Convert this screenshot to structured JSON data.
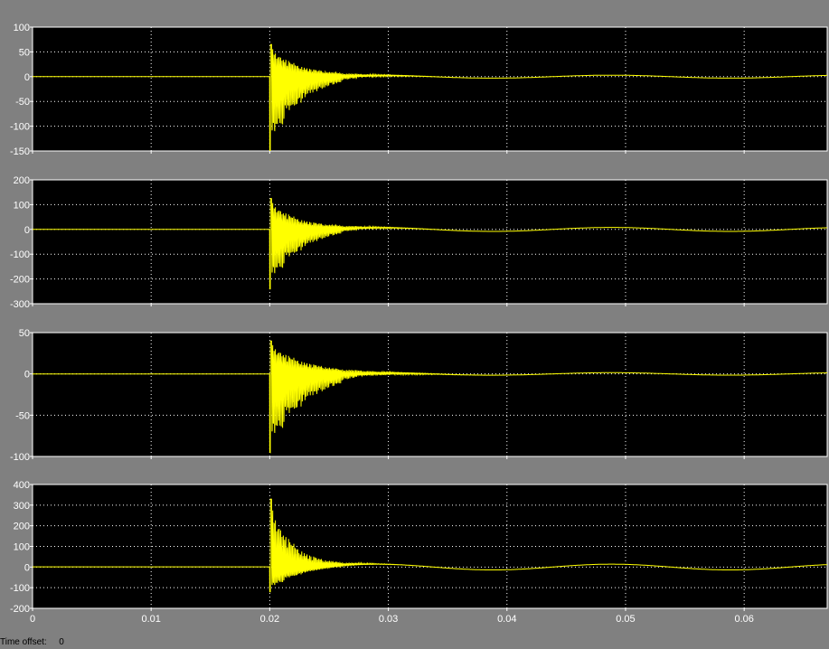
{
  "window": {
    "background": "#808080",
    "time_offset_label": "Time offset:",
    "time_offset_value": "0"
  },
  "colors": {
    "axes_background": "#000000",
    "axes_border": "#ffffff",
    "grid": "#ffffff",
    "signal": "#ffff00",
    "tick_text": "#ffffff"
  },
  "chart_data": [
    {
      "type": "line",
      "title": "",
      "xlabel": "",
      "ylabel": "",
      "xlim": [
        0,
        0.067
      ],
      "ylim": [
        -150,
        100
      ],
      "yticks": [
        -150,
        -100,
        -50,
        0,
        50,
        100
      ],
      "xticks": [
        0,
        0.01,
        0.02,
        0.03,
        0.04,
        0.05,
        0.06
      ],
      "x_tick_labels_shown": false,
      "grid": true,
      "legend": "none",
      "series": [
        {
          "x": [
            0,
            0.02,
            0.0201,
            0.0202,
            0.0204,
            0.0207,
            0.021,
            0.0215,
            0.022,
            0.023,
            0.025,
            0.03,
            0.035,
            0.04,
            0.045,
            0.05,
            0.055,
            0.06,
            0.065,
            0.067
          ],
          "y": [
            0,
            0,
            -140,
            62,
            -75,
            48,
            -30,
            28,
            -18,
            12,
            6,
            1,
            -1,
            0,
            2,
            0,
            -1,
            0,
            1,
            0
          ],
          "transient_start": 0.02,
          "transient_peak": 65,
          "transient_trough": -150,
          "decay_time": 0.0025,
          "ripple": 3
        }
      ]
    },
    {
      "type": "line",
      "title": "",
      "xlabel": "",
      "ylabel": "",
      "xlim": [
        0,
        0.067
      ],
      "ylim": [
        -300,
        200
      ],
      "yticks": [
        -300,
        -200,
        -100,
        0,
        100,
        200
      ],
      "xticks": [
        0,
        0.01,
        0.02,
        0.03,
        0.04,
        0.05,
        0.06
      ],
      "x_tick_labels_shown": false,
      "grid": true,
      "legend": "none",
      "series": [
        {
          "x": [
            0,
            0.02,
            0.0201,
            0.0203,
            0.0205,
            0.0208,
            0.021,
            0.0215,
            0.022,
            0.023,
            0.025,
            0.03,
            0.035,
            0.04,
            0.045,
            0.05,
            0.055,
            0.06,
            0.065,
            0.067
          ],
          "y": [
            0,
            0,
            -235,
            125,
            -110,
            70,
            -60,
            45,
            -30,
            22,
            12,
            4,
            -4,
            -4,
            8,
            4,
            -6,
            -8,
            4,
            6
          ],
          "transient_start": 0.02,
          "transient_peak": 125,
          "transient_trough": -240,
          "decay_time": 0.0025,
          "ripple": 8
        }
      ]
    },
    {
      "type": "line",
      "title": "",
      "xlabel": "",
      "ylabel": "",
      "xlim": [
        0,
        0.067
      ],
      "ylim": [
        -100,
        50
      ],
      "yticks": [
        -100,
        -50,
        0,
        50
      ],
      "xticks": [
        0,
        0.01,
        0.02,
        0.03,
        0.04,
        0.05,
        0.06
      ],
      "x_tick_labels_shown": false,
      "grid": true,
      "legend": "none",
      "series": [
        {
          "x": [
            0,
            0.02,
            0.0201,
            0.0202,
            0.0204,
            0.0207,
            0.021,
            0.0215,
            0.022,
            0.023,
            0.025,
            0.03,
            0.035,
            0.04,
            0.045,
            0.05,
            0.055,
            0.06,
            0.065,
            0.067
          ],
          "y": [
            0,
            0,
            -92,
            38,
            -48,
            32,
            -28,
            22,
            -15,
            10,
            4,
            1,
            -1,
            0,
            1,
            0,
            -1,
            0,
            1,
            0
          ],
          "transient_start": 0.02,
          "transient_peak": 40,
          "transient_trough": -95,
          "decay_time": 0.003,
          "ripple": 1.5
        }
      ]
    },
    {
      "type": "line",
      "title": "",
      "xlabel": "",
      "ylabel": "",
      "xlim": [
        0,
        0.067
      ],
      "ylim": [
        -200,
        400
      ],
      "yticks": [
        -200,
        -100,
        0,
        100,
        200,
        300,
        400
      ],
      "xticks": [
        0,
        0.01,
        0.02,
        0.03,
        0.04,
        0.05,
        0.06
      ],
      "xtick_labels": [
        "0",
        "0.01",
        "0.02",
        "0.03",
        "0.04",
        "0.05",
        "0.06"
      ],
      "x_tick_labels_shown": true,
      "grid": true,
      "legend": "none",
      "series": [
        {
          "x": [
            0,
            0.019,
            0.02,
            0.0201,
            0.0203,
            0.0205,
            0.0207,
            0.021,
            0.0215,
            0.022,
            0.025,
            0.028,
            0.032,
            0.035,
            0.04,
            0.045,
            0.05,
            0.055,
            0.06,
            0.065,
            0.067
          ],
          "y": [
            1,
            1,
            5,
            320,
            130,
            -110,
            60,
            -90,
            20,
            -20,
            -10,
            -12,
            8,
            14,
            -2,
            -14,
            0,
            14,
            2,
            -14,
            -10
          ],
          "transient_start": 0.02,
          "transient_peak": 330,
          "transient_trough": -120,
          "decay_time": 0.002,
          "ripple": 14
        }
      ]
    }
  ]
}
